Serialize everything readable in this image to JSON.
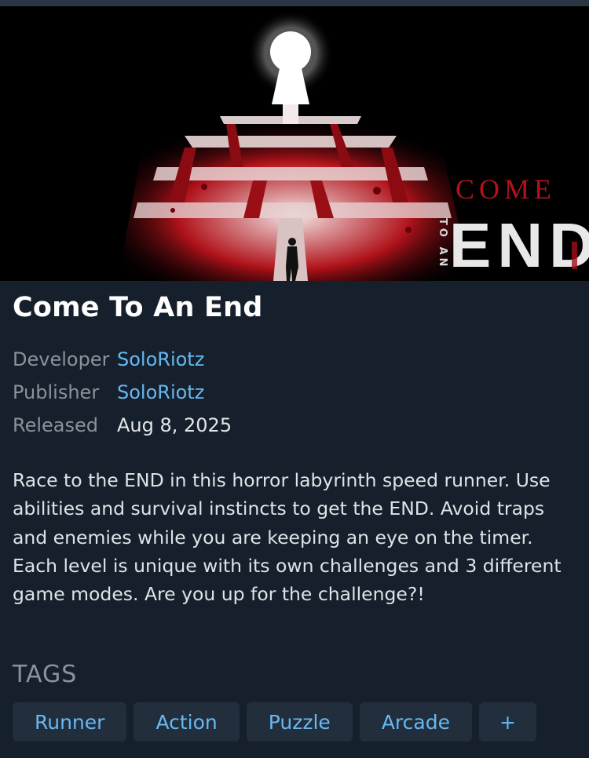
{
  "game": {
    "title": "Come To An End",
    "cover_art": {
      "logo_text_top": "COME",
      "logo_text_side": "TO AN",
      "logo_text_main": "END"
    }
  },
  "meta": {
    "developer_label": "Developer",
    "developer_value": "SoloRiotz",
    "publisher_label": "Publisher",
    "publisher_value": "SoloRiotz",
    "released_label": "Released",
    "released_value": "Aug 8, 2025"
  },
  "description": "Race to the END in this horror labyrinth speed runner. Use abilities and survival instincts to get the END. Avoid traps and enemies while you are keeping an eye on the timer. Each level is unique with its own challenges and 3 different game modes. Are you up for the challenge?!",
  "tags": {
    "heading": "TAGS",
    "items": [
      {
        "label": "Runner"
      },
      {
        "label": "Action"
      },
      {
        "label": "Puzzle"
      },
      {
        "label": "Arcade"
      },
      {
        "label": "+"
      }
    ]
  },
  "colors": {
    "background": "#16202c",
    "link": "#66b8f2",
    "tag_background": "#222e3c",
    "muted_text": "#8a929c"
  }
}
